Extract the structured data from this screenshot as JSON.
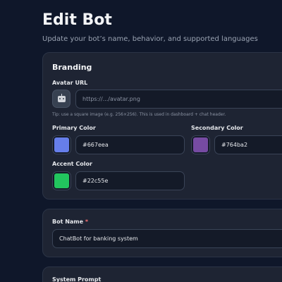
{
  "header": {
    "title": "Edit Bot",
    "subtitle": "Update your bot’s name, behavior, and supported languages"
  },
  "branding": {
    "section_title": "Branding",
    "avatar": {
      "label": "Avatar URL",
      "placeholder": "https://.../avatar.png",
      "hint": "Tip: use a square image (e.g. 256×256). This is used in dashboard + chat header.",
      "icon": "bot-icon"
    },
    "primary_color": {
      "label": "Primary Color",
      "value": "#667eea",
      "swatch": "#667eea"
    },
    "secondary_color": {
      "label": "Secondary Color",
      "value": "#764ba2",
      "swatch": "#764ba2"
    },
    "accent_color": {
      "label": "Accent Color",
      "value": "#22c55e",
      "swatch": "#22c55e"
    }
  },
  "bot_name": {
    "label": "Bot Name",
    "required_mark": "*",
    "value": "ChatBot for banking system"
  },
  "system_prompt": {
    "label": "System Prompt"
  }
}
